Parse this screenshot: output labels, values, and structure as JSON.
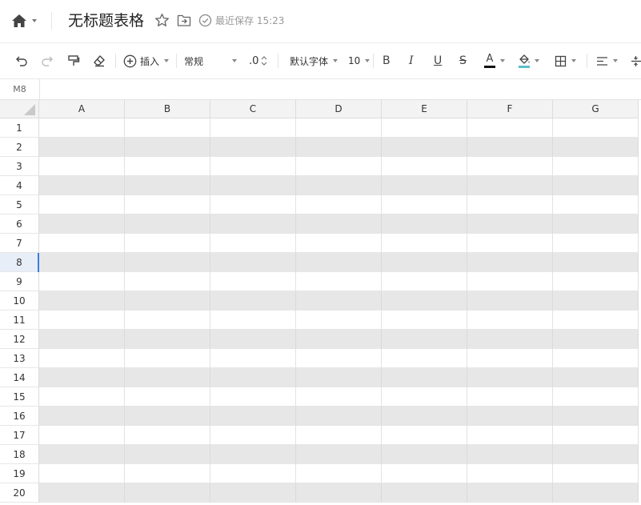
{
  "header": {
    "title": "无标题表格",
    "saved_status": "最近保存 15:23",
    "icons": [
      "home-icon",
      "star-icon",
      "move-to-folder-icon",
      "saved-check-icon"
    ]
  },
  "toolbar": {
    "insert_label": "插入",
    "number_format": "常规",
    "decimal_label": ".0",
    "font_family": "默认字体",
    "font_size": "10",
    "bold_label": "B",
    "italic_label": "I",
    "underline_label": "U",
    "strike_label": "S",
    "text_color_label": "A",
    "colors": {
      "text_color_bar": "#111111",
      "fill_color_bar": "#5bc0c9",
      "selection_accent": "#3b7ddd",
      "shaded_row": "#e7e7e7"
    }
  },
  "formula_bar": {
    "cell_reference": "M8"
  },
  "grid": {
    "columns": [
      "A",
      "B",
      "C",
      "D",
      "E",
      "F",
      "G"
    ],
    "rows": [
      "1",
      "2",
      "3",
      "4",
      "5",
      "6",
      "7",
      "8",
      "9",
      "10",
      "11",
      "12",
      "13",
      "14",
      "15",
      "16",
      "17",
      "18",
      "19",
      "20"
    ],
    "active_row": "8"
  }
}
